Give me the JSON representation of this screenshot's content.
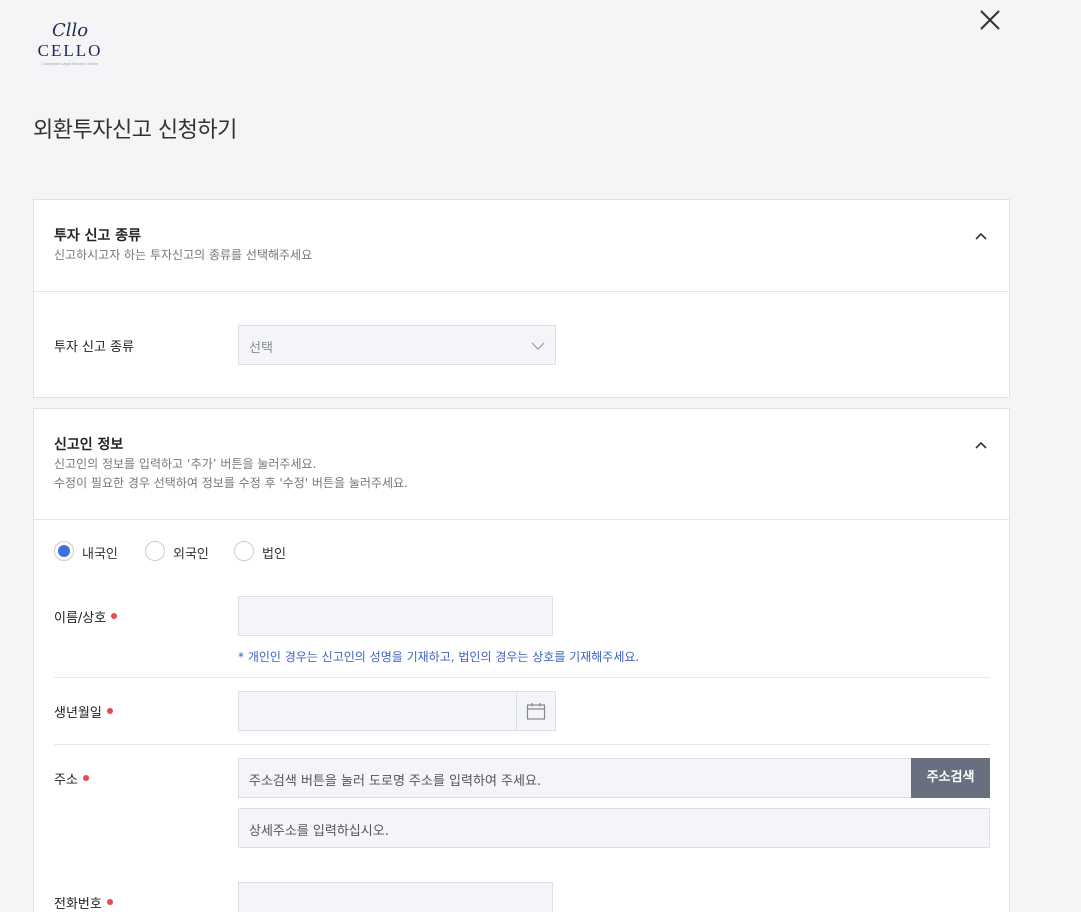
{
  "logo": {
    "script": "Cllo",
    "word": "CELLO",
    "tagline": "Corporate Legal Service Online"
  },
  "page": {
    "title": "외환투자신고 신청하기"
  },
  "section_type": {
    "title": "투자 신고 종류",
    "subtitle": "신고하시고자 하는 투자신고의 종류를 선택해주세요",
    "field_label": "투자 신고 종류",
    "select_value": "선택"
  },
  "section_reporter": {
    "title": "신고인 정보",
    "subtitle_1": "신고인의 정보를 입력하고 ‘추가’ 버튼을 눌러주세요.",
    "subtitle_2": "수정이 필요한 경우 선택하여 정보를 수정 후 '수정' 버튼을 눌러주세요.",
    "radios": [
      {
        "label": "내국인",
        "selected": true
      },
      {
        "label": "외국인",
        "selected": false
      },
      {
        "label": "법인",
        "selected": false
      }
    ],
    "name_label": "이름/상호",
    "name_hint": "* 개인인 경우는 신고인의 성명을 기재하고, 법인의 경우는 상호를 기재해주세요.",
    "birth_label": "생년월일",
    "address_label": "주소",
    "address_placeholder": "주소검색 버튼을 눌러 도로명 주소를 입력하여 주세요.",
    "address_button": "주소검색",
    "address_detail_placeholder": "상세주소를 입력하십시오.",
    "phone_label": "전화번호"
  },
  "colors": {
    "accent": "#3e6fe0",
    "required": "#e84a4a",
    "hint": "#3e62c6",
    "button": "#68707f"
  }
}
